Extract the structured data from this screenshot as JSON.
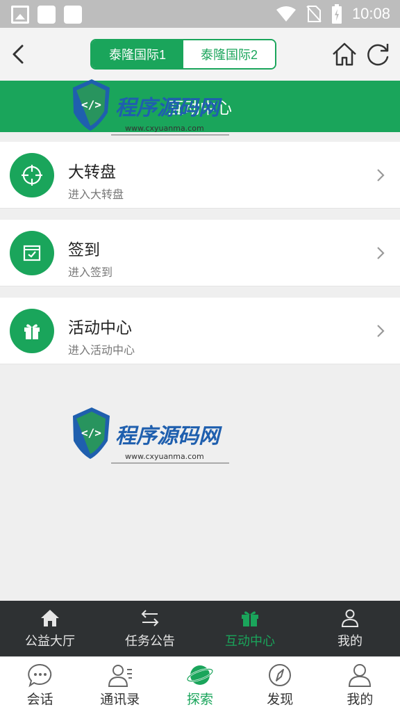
{
  "status_bar": {
    "time": "10:08"
  },
  "top_bar": {
    "segments": [
      "泰隆国际1",
      "泰隆国际2"
    ],
    "active_segment": 0
  },
  "header": {
    "title": "互动中心"
  },
  "list": [
    {
      "title": "大转盘",
      "subtitle": "进入大转盘",
      "icon": "target-icon"
    },
    {
      "title": "签到",
      "subtitle": "进入签到",
      "icon": "calendar-check-icon"
    },
    {
      "title": "活动中心",
      "subtitle": "进入活动中心",
      "icon": "gift-icon"
    }
  ],
  "watermark": {
    "text": "程序源码网",
    "url": "www.cxyuanma.com"
  },
  "tab_bar_top": [
    {
      "label": "公益大厅",
      "icon": "home-icon",
      "active": false
    },
    {
      "label": "任务公告",
      "icon": "swap-icon",
      "active": false
    },
    {
      "label": "互动中心",
      "icon": "gift-icon",
      "active": true
    },
    {
      "label": "我的",
      "icon": "user-icon",
      "active": false
    }
  ],
  "tab_bar_bottom": [
    {
      "label": "会话",
      "icon": "chat-icon",
      "active": false
    },
    {
      "label": "通讯录",
      "icon": "contacts-icon",
      "active": false
    },
    {
      "label": "探索",
      "icon": "planet-icon",
      "active": true
    },
    {
      "label": "发现",
      "icon": "compass-icon",
      "active": false
    },
    {
      "label": "我的",
      "icon": "user-icon",
      "active": false
    }
  ],
  "colors": {
    "accent": "#1aa55b",
    "dark_bar": "#2e3133",
    "status_bar": "#bdbdbd",
    "background": "#efefef"
  }
}
